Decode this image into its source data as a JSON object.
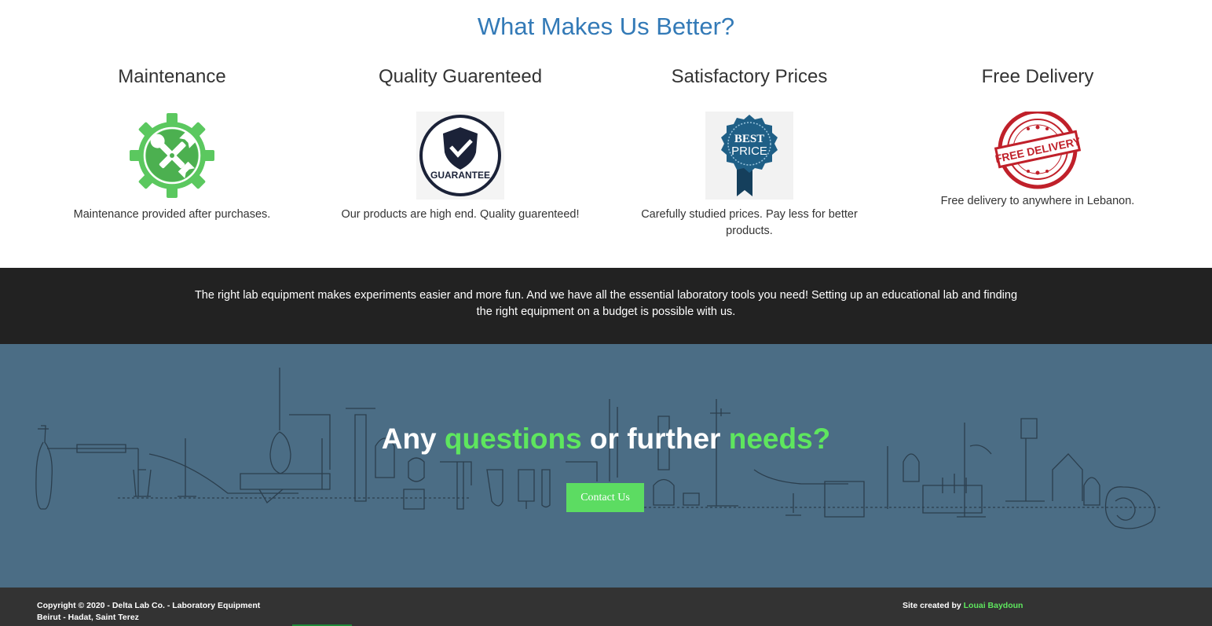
{
  "features": {
    "title": "What Makes Us Better?",
    "items": [
      {
        "title": "Maintenance",
        "icon": "maintenance-gear-wrench-icon",
        "description": "Maintenance provided after purchases."
      },
      {
        "title": "Quality Guarenteed",
        "icon": "guarantee-shield-icon",
        "description": "Our products are high end. Quality guarenteed!",
        "badge_text": "GUARANTEE"
      },
      {
        "title": "Satisfactory Prices",
        "icon": "best-price-ribbon-icon",
        "description": "Carefully studied prices. Pay less for better products.",
        "badge_line1": "BEST",
        "badge_line2": "PRICE"
      },
      {
        "title": "Free Delivery",
        "icon": "free-delivery-stamp-icon",
        "description": "Free delivery to anywhere in Lebanon.",
        "badge_text": "FREE DELIVERY"
      }
    ]
  },
  "blurb": {
    "text": "The right lab equipment makes experiments easier and more fun. And we have all the essential laboratory tools you need! Setting up an educational lab and finding the right equipment on a budget is possible with us."
  },
  "cta": {
    "heading_part1": "Any ",
    "heading_highlight1": "questions",
    "heading_part2": " or further ",
    "heading_highlight2": "needs?",
    "button_label": "Contact Us",
    "background_art": "lab-equipment-illustration"
  },
  "footer": {
    "copyright_line1": "Copyright © 2020 - Delta Lab Co. - Laboratory Equipment",
    "copyright_line2": "Beirut - Hadat, Saint Terez",
    "credit_prefix": "Site created by ",
    "credit_name": "Louai Baydoun"
  },
  "colors": {
    "title_blue": "#337ab7",
    "accent_green": "#5ee65e",
    "cta_background": "#4b6d85",
    "dark_band": "#222222",
    "footer_background": "#333333",
    "stamp_red": "#c0202a",
    "ribbon_blue": "#1f5f86"
  }
}
